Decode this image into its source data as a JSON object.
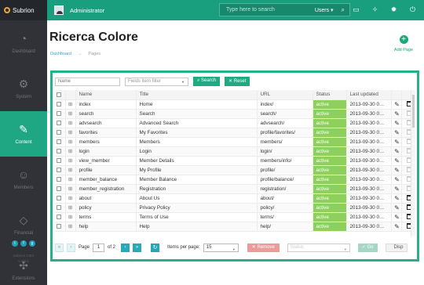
{
  "brand": {
    "name": "Subrion"
  },
  "header": {
    "user_name": "Administrator",
    "search_placeholder": "Type here to search",
    "search_scope": "Users",
    "icons": [
      "monitor-icon",
      "clean-cache-icon",
      "settings-icon",
      "power-icon"
    ]
  },
  "sidebar": {
    "items": [
      {
        "label": "Dashboard",
        "icon": "gauge-icon",
        "glyph": "◔",
        "active": false
      },
      {
        "label": "System",
        "icon": "gear-icon",
        "glyph": "⚙",
        "active": false
      },
      {
        "label": "Content",
        "icon": "pencil-icon",
        "glyph": "✎",
        "active": true
      },
      {
        "label": "Members",
        "icon": "user-icon",
        "glyph": "☺",
        "active": false
      },
      {
        "label": "Financial",
        "icon": "tag-icon",
        "glyph": "◇",
        "active": false
      },
      {
        "label": "Extensions",
        "icon": "puzzle-icon",
        "glyph": "✣",
        "active": false
      }
    ],
    "social": [
      {
        "icon": "twitter-icon",
        "glyph": "t"
      },
      {
        "icon": "facebook-icon",
        "glyph": "f"
      },
      {
        "icon": "google-plus-icon",
        "glyph": "g"
      }
    ],
    "version_line1": "Subrion CMS",
    "version_line2": "v 3.6.1"
  },
  "page": {
    "title": "Ricerca Colore",
    "breadcrumb": [
      "Dashboard",
      "Pages"
    ],
    "add_label": "Add Page"
  },
  "filters": {
    "name_placeholder": "Name",
    "fields_placeholder": "Fields item filter",
    "search_button": "Search",
    "reset_button": "Reset"
  },
  "table": {
    "columns": [
      "",
      "",
      "Name",
      "Title",
      "URL",
      "Status",
      "Last updated",
      "",
      ""
    ],
    "rows": [
      {
        "name": "index",
        "title": "Home",
        "url": "index/",
        "status": "active",
        "updated": "2013-09-30 0…",
        "deletable": true
      },
      {
        "name": "search",
        "title": "Search",
        "url": "search/",
        "status": "active",
        "updated": "2013-09-30 0…",
        "deletable": false
      },
      {
        "name": "advsearch",
        "title": "Advanced Search",
        "url": "advsearch/",
        "status": "active",
        "updated": "2013-09-30 0…",
        "deletable": false
      },
      {
        "name": "favorites",
        "title": "My Favorites",
        "url": "profile/favorites/",
        "status": "active",
        "updated": "2013-09-30 0…",
        "deletable": false
      },
      {
        "name": "members",
        "title": "Members",
        "url": "members/",
        "status": "active",
        "updated": "2013-09-30 0…",
        "deletable": false
      },
      {
        "name": "login",
        "title": "Login",
        "url": "login/",
        "status": "active",
        "updated": "2013-09-30 0…",
        "deletable": false
      },
      {
        "name": "view_member",
        "title": "Member Details",
        "url": "members/info/",
        "status": "active",
        "updated": "2013-09-30 0…",
        "deletable": false
      },
      {
        "name": "profile",
        "title": "My Profile",
        "url": "profile/",
        "status": "active",
        "updated": "2013-09-30 0…",
        "deletable": false
      },
      {
        "name": "member_balance",
        "title": "Member Balance",
        "url": "profile/balance/",
        "status": "active",
        "updated": "2013-09-30 0…",
        "deletable": false
      },
      {
        "name": "member_registration",
        "title": "Registration",
        "url": "registration/",
        "status": "active",
        "updated": "2013-09-30 0…",
        "deletable": false
      },
      {
        "name": "about",
        "title": "About Us",
        "url": "about/",
        "status": "active",
        "updated": "2013-09-30 0…",
        "deletable": true
      },
      {
        "name": "policy",
        "title": "Privacy Policy",
        "url": "policy/",
        "status": "active",
        "updated": "2013-09-30 0…",
        "deletable": true
      },
      {
        "name": "terms",
        "title": "Terms of Use",
        "url": "terms/",
        "status": "active",
        "updated": "2013-09-30 0…",
        "deletable": true
      },
      {
        "name": "help",
        "title": "Help",
        "url": "help/",
        "status": "active",
        "updated": "2013-09-30 0…",
        "deletable": true
      }
    ]
  },
  "pager": {
    "page_label": "Page",
    "current_page": "1",
    "total_label": "of 2",
    "per_page_label": "Items per page:",
    "per_page_value": "15",
    "remove_label": "Remove",
    "status_placeholder": "Status",
    "go_label": "Go",
    "display_label": "Disp"
  },
  "colors": {
    "accent": "#1a9f7e",
    "active_status": "#8dd15c",
    "sidebar": "#303237"
  }
}
